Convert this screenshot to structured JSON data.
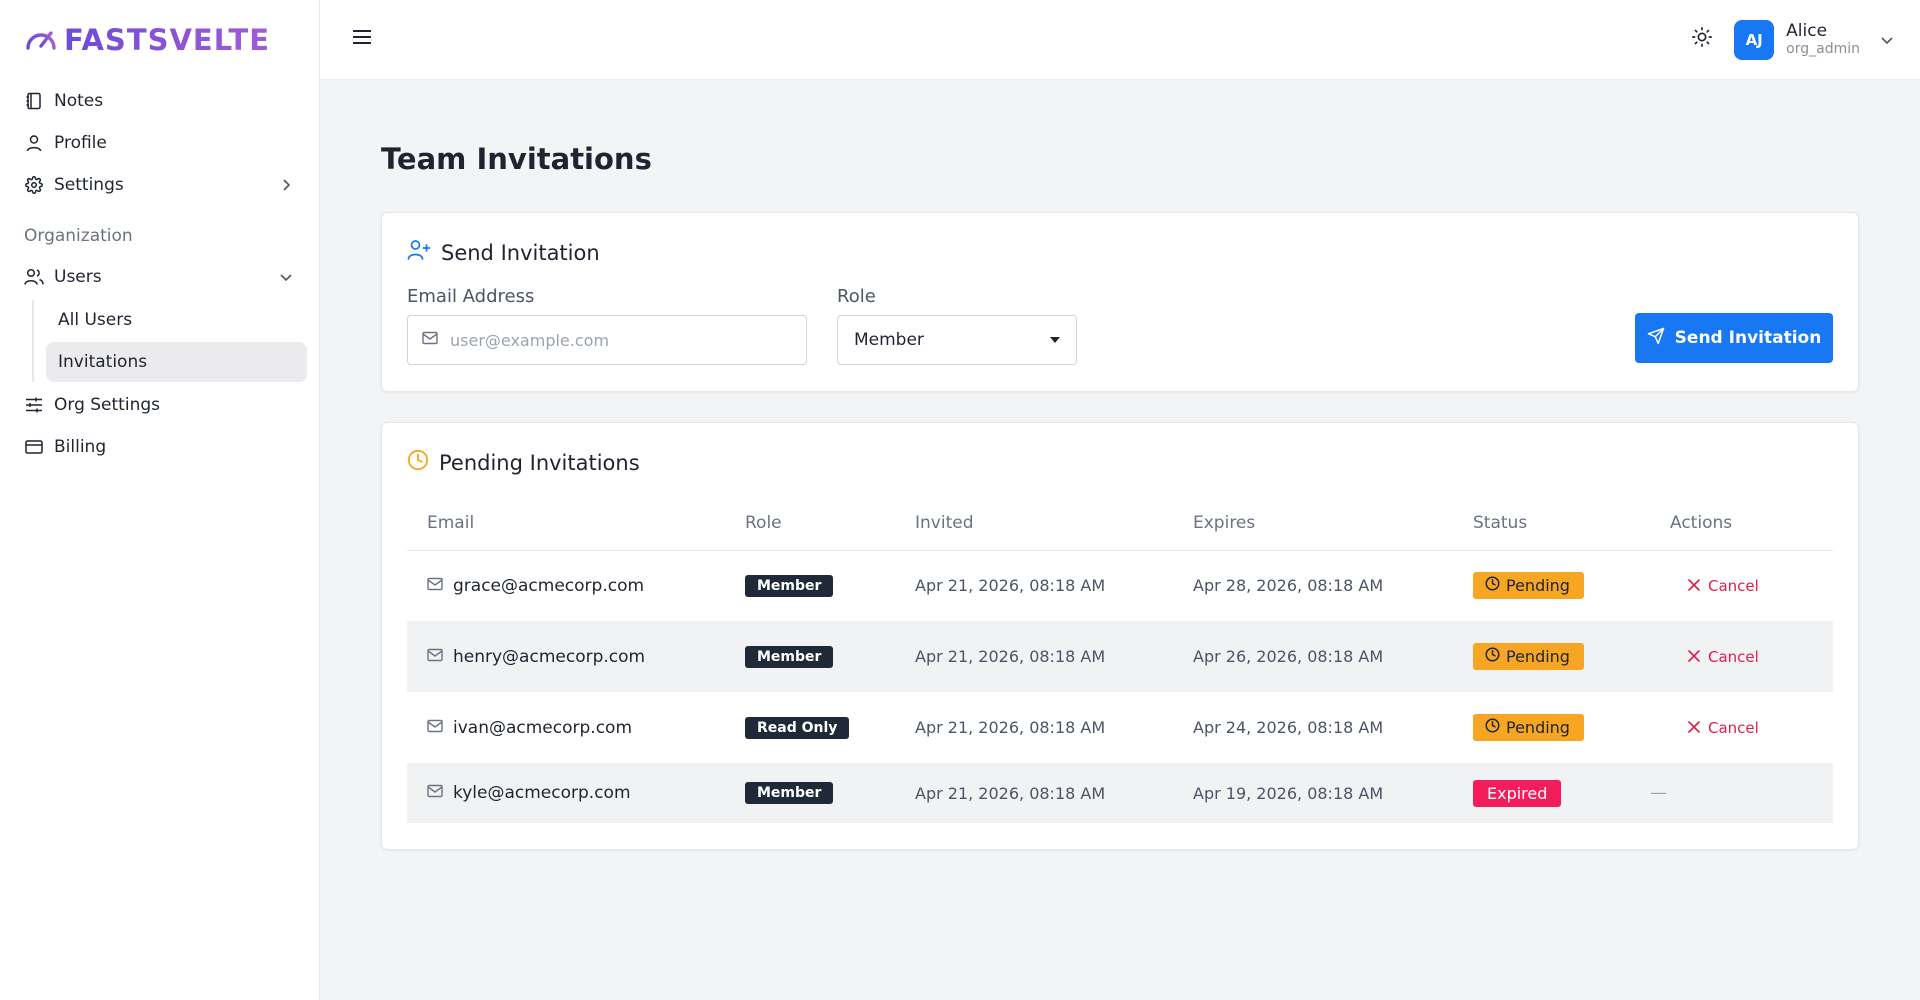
{
  "brand": {
    "name": "FASTSVELTE"
  },
  "sidebar": {
    "items": [
      {
        "label": "Notes"
      },
      {
        "label": "Profile"
      },
      {
        "label": "Settings"
      }
    ],
    "section_title": "Organization",
    "org_items": [
      {
        "label": "Users"
      },
      {
        "label": "Org Settings"
      },
      {
        "label": "Billing"
      }
    ],
    "users_sub": [
      {
        "label": "All Users"
      },
      {
        "label": "Invitations"
      }
    ]
  },
  "topbar": {
    "user": {
      "initials": "AJ",
      "name": "Alice",
      "role": "org_admin"
    }
  },
  "page": {
    "title": "Team Invitations"
  },
  "send_card": {
    "title": "Send Invitation",
    "email_label": "Email Address",
    "email_placeholder": "user@example.com",
    "email_value": "",
    "role_label": "Role",
    "role_value": "Member",
    "button_label": "Send Invitation"
  },
  "pending_card": {
    "title": "Pending Invitations",
    "columns": [
      "Email",
      "Role",
      "Invited",
      "Expires",
      "Status",
      "Actions"
    ],
    "rows": [
      {
        "email": "grace@acmecorp.com",
        "role": "Member",
        "invited": "Apr 21, 2026, 08:18 AM",
        "expires": "Apr 28, 2026, 08:18 AM",
        "status": "Pending",
        "action": "Cancel"
      },
      {
        "email": "henry@acmecorp.com",
        "role": "Member",
        "invited": "Apr 21, 2026, 08:18 AM",
        "expires": "Apr 26, 2026, 08:18 AM",
        "status": "Pending",
        "action": "Cancel"
      },
      {
        "email": "ivan@acmecorp.com",
        "role": "Read Only",
        "invited": "Apr 21, 2026, 08:18 AM",
        "expires": "Apr 24, 2026, 08:18 AM",
        "status": "Pending",
        "action": "Cancel"
      },
      {
        "email": "kyle@acmecorp.com",
        "role": "Member",
        "invited": "Apr 21, 2026, 08:18 AM",
        "expires": "Apr 19, 2026, 08:18 AM",
        "status": "Expired",
        "action": "—"
      }
    ]
  },
  "colors": {
    "primary": "#1877f2",
    "pending": "#f6a623",
    "expired": "#f21d5a",
    "cancel": "#e11d48",
    "brand": "#7c4ddb"
  }
}
